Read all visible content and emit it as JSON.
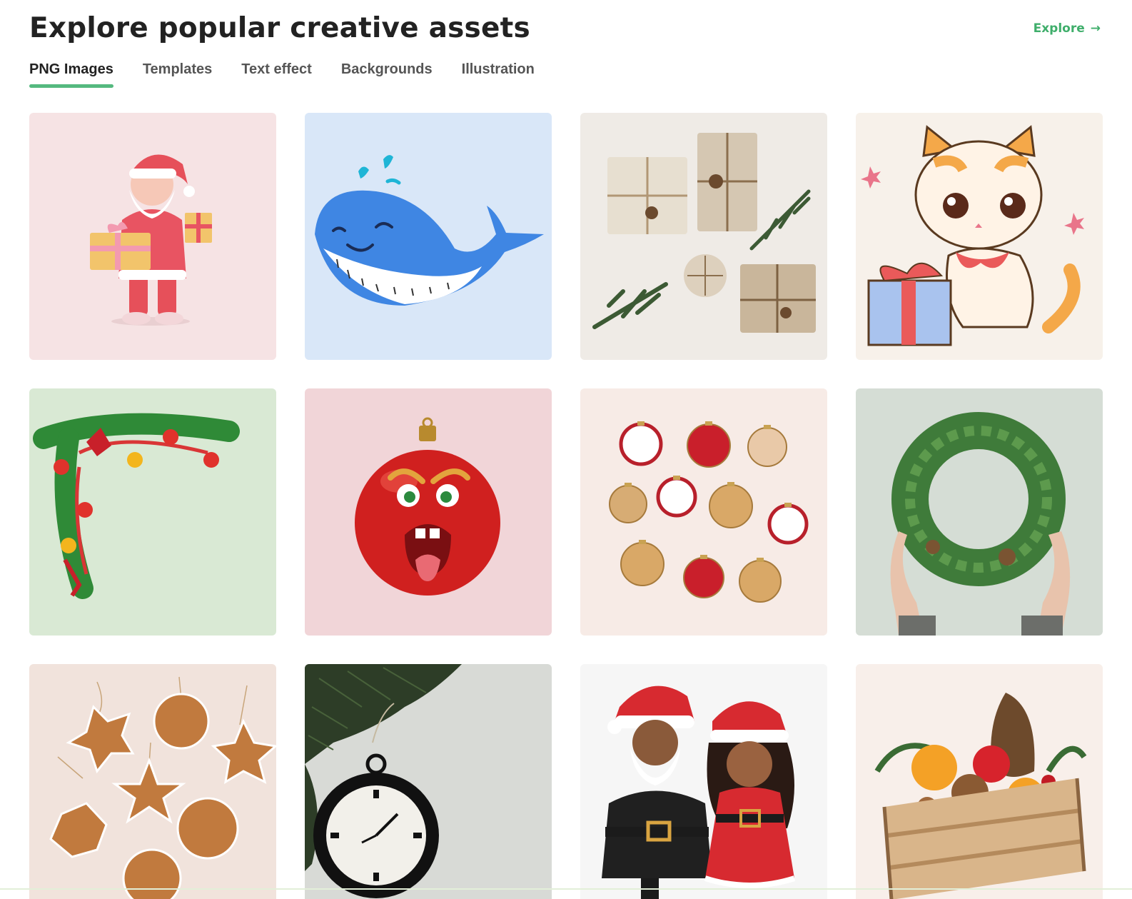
{
  "header": {
    "title": "Explore popular creative assets",
    "explore_label": "Explore",
    "explore_icon": "arrow-right-icon",
    "accent_color": "#3fae6b"
  },
  "tabs": [
    {
      "label": "PNG Images",
      "active": true
    },
    {
      "label": "Templates",
      "active": false
    },
    {
      "label": "Text effect",
      "active": false
    },
    {
      "label": "Backgrounds",
      "active": false
    },
    {
      "label": "Illustration",
      "active": false
    }
  ],
  "assets": [
    {
      "subject": "santa-with-gifts",
      "bg": "#f6e3e4"
    },
    {
      "subject": "blue-whale",
      "bg": "#d9e7f8"
    },
    {
      "subject": "kraft-gift-boxes",
      "bg": "#efebe6"
    },
    {
      "subject": "kitten-with-gift",
      "bg": "#f7f1ea"
    },
    {
      "subject": "christmas-garland-corner",
      "bg": "#d9e9d4"
    },
    {
      "subject": "angry-red-ornament",
      "bg": "#f1d5d8"
    },
    {
      "subject": "christmas-baubles",
      "bg": "#f7ebe6"
    },
    {
      "subject": "hands-holding-wreath",
      "bg": "#d5ddd5"
    },
    {
      "subject": "gingerbread-cookies",
      "bg": "#f1e3dc"
    },
    {
      "subject": "pocket-watch-on-branch",
      "bg": "#d8dad6"
    },
    {
      "subject": "santa-and-girl",
      "bg": "#f6f6f6"
    },
    {
      "subject": "fruit-crate",
      "bg": "#f8efea"
    }
  ]
}
